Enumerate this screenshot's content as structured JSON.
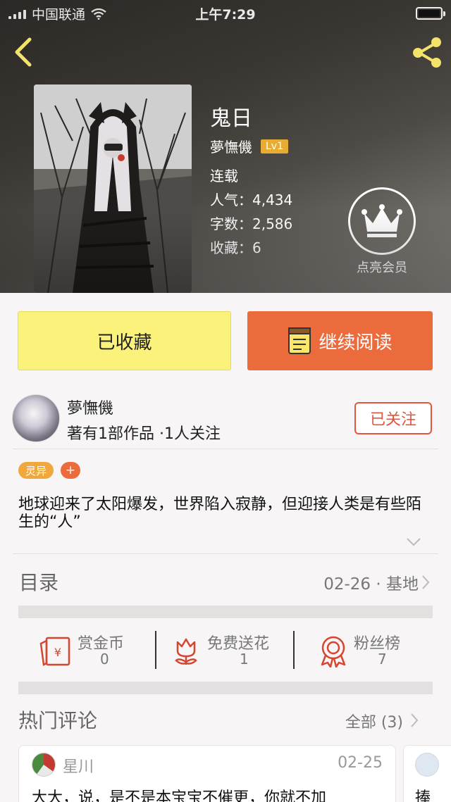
{
  "status_bar": {
    "carrier": "中国联通",
    "time": "上午7:29"
  },
  "header": {
    "back_icon": "chevron-left-icon",
    "share_icon": "share-icon"
  },
  "book": {
    "title": "鬼日",
    "author": "夢憮僟",
    "level": "Lv1",
    "status": "连载",
    "popularity": "人气：4,434",
    "words": "字数：2,586",
    "favorites": "收藏：6"
  },
  "vip": {
    "label": "点亮会员",
    "icon": "crown-icon"
  },
  "actions": {
    "collect_label": "已收藏",
    "read_label": "继续阅读",
    "read_icon": "book-icon"
  },
  "author_block": {
    "name": "夢憮僟",
    "stats": "著有1部作品 ·1人关注",
    "follow_label": "已关注"
  },
  "tags": {
    "genre": "灵异",
    "add": "+"
  },
  "description": "地球迎来了太阳爆发，世界陷入寂静，但迎接人类是有些陌生的“人”",
  "toc": {
    "title": "目录",
    "latest": "02-26 · 基地"
  },
  "stats": [
    {
      "label": "赏金币",
      "value": "0",
      "icon": "red-envelope-icon"
    },
    {
      "label": "免费送花",
      "value": "1",
      "icon": "flower-icon"
    },
    {
      "label": "粉丝榜",
      "value": "7",
      "icon": "medal-icon"
    }
  ],
  "comments": {
    "title": "热门评论",
    "all_label": "全部 (3)",
    "items": [
      {
        "user": "星川",
        "date": "02-25",
        "text": "大大，说，是不是本宝宝不催更，你就不加"
      },
      {
        "text": "捧"
      }
    ]
  },
  "colors": {
    "accent": "#ec6b3d",
    "collected": "#fbf27b",
    "follow": "#e5553c",
    "level": "#e8ac33"
  }
}
